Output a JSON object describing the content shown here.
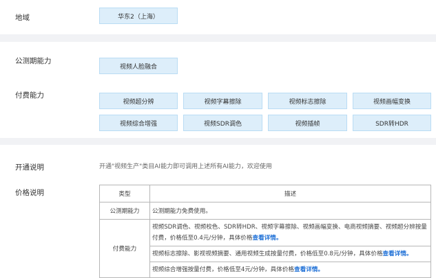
{
  "region": {
    "label": "地域",
    "option": "华东2（上海）"
  },
  "capabilities": {
    "beta_label": "公测期能力",
    "beta_options": [
      "视频人脸融合"
    ],
    "paid_label": "付费能力",
    "paid_options": [
      "视频超分辨",
      "视频字幕擦除",
      "视频标志擦除",
      "视频画幅变换",
      "视频综合增强",
      "视频SDR调色",
      "视频插帧",
      "SDR转HDR"
    ]
  },
  "activation": {
    "label": "开通说明",
    "text": "开通\"视频生产\"类目AI能力即可调用上述所有AI能力，欢迎使用"
  },
  "pricing": {
    "label": "价格说明",
    "headers": [
      "类型",
      "描述"
    ],
    "beta_row": {
      "type": "公测期能力",
      "desc": "公测期能力免费使用。"
    },
    "paid_type": "付费能力",
    "paid_rows": [
      {
        "text": "视频SDR调色、视频校色、SDR转HDR、视频字幕擦除、视频画幅变换、电商视频摘要、视频超分辨按量付费，价格低至0.4元/分钟，具体价格",
        "link": "查看详情。"
      },
      {
        "text": "视频标志擦除、影视视频摘要、通用视频生成按量付费，价格低至0.8元/分钟，具体价格",
        "link": "查看详情。"
      },
      {
        "text": "视频综合增强按量付费，价格低至4元/分钟，具体价格",
        "link": "查看详情。"
      }
    ]
  }
}
